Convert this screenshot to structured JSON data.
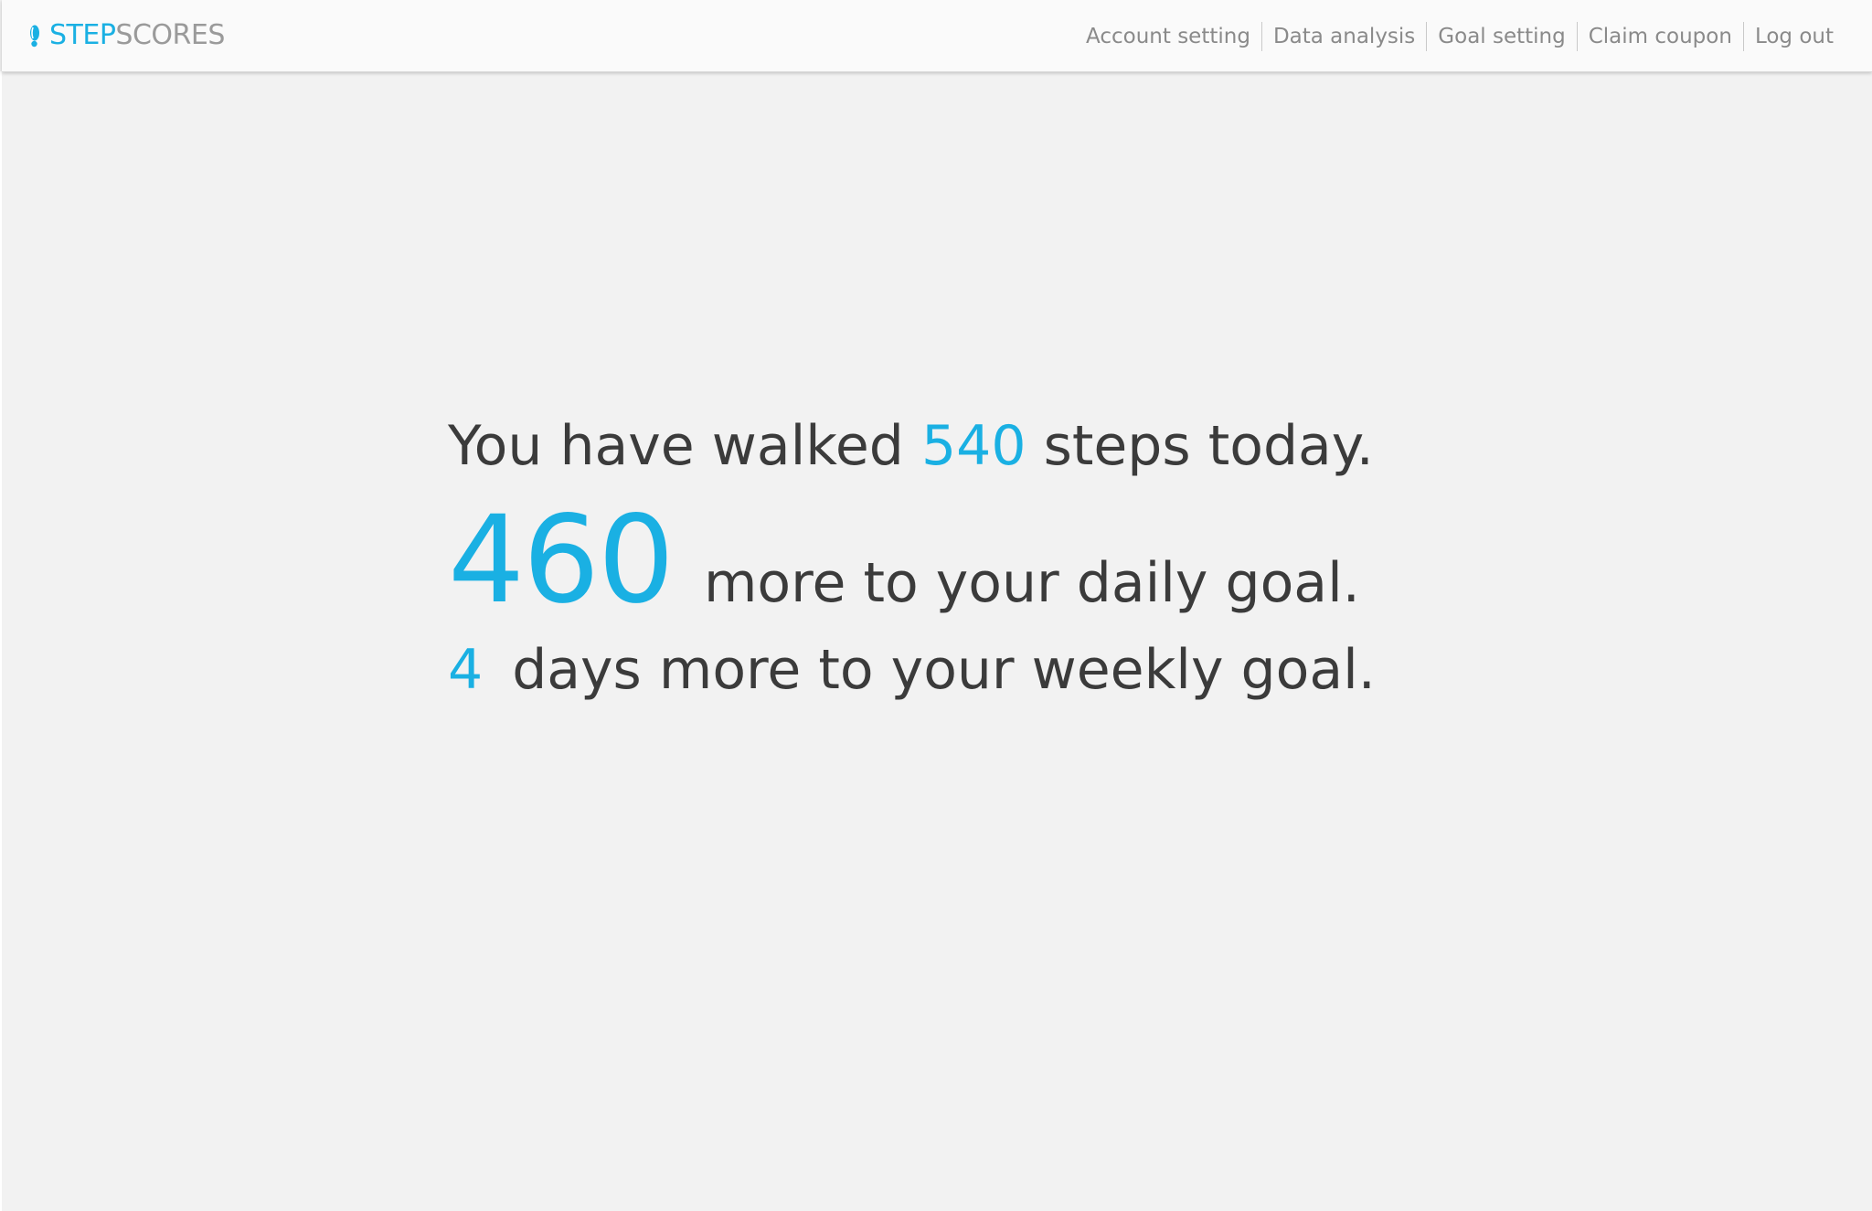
{
  "colors": {
    "accent": "#1ab0e3",
    "text": "#3b3b3b",
    "nav_text": "#8a8a8a",
    "background": "#f2f2f2",
    "header_background": "#fafafa"
  },
  "header": {
    "logo": {
      "icon": "footprint-icon",
      "text_step": "STEP",
      "text_scores": "SCORES"
    },
    "nav": [
      {
        "label": "Account setting"
      },
      {
        "label": "Data analysis"
      },
      {
        "label": "Goal setting"
      },
      {
        "label": "Claim coupon"
      },
      {
        "label": "Log out"
      }
    ]
  },
  "main": {
    "steps_prefix": "You have walked",
    "steps_today": "540",
    "steps_suffix": "steps today.",
    "daily_remaining": "460",
    "daily_text": "more to your daily goal.",
    "weekly_remaining": "4",
    "weekly_text": "days more to your weekly goal."
  }
}
